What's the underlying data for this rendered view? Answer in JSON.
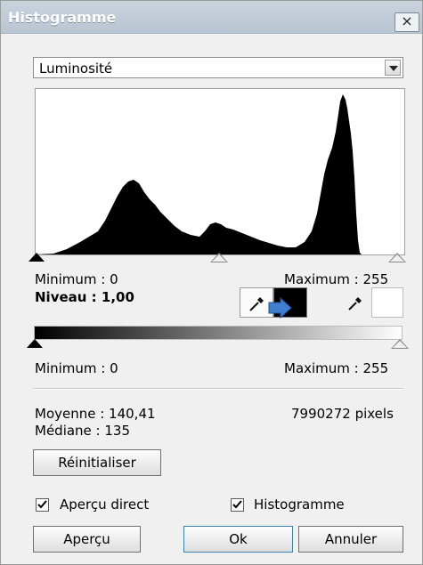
{
  "window": {
    "title": "Histogramme",
    "close_label": "×"
  },
  "channel": {
    "selected": "Luminosité"
  },
  "histogram": {
    "input_minimum": "Minimum : 0",
    "input_maximum": "Maximum : 255",
    "level": "Niveau : 1,00"
  },
  "output": {
    "minimum": "Minimum : 0",
    "maximum": "Maximum : 255"
  },
  "stats": {
    "mean": "Moyenne : 140,41",
    "median": "Médiane : 135",
    "pixels": "7990272 pixels"
  },
  "buttons": {
    "reset": "Réinitialiser",
    "preview": "Aperçu",
    "ok": "Ok",
    "cancel": "Annuler"
  },
  "options": {
    "live_preview": {
      "label": "Aperçu direct",
      "checked": true
    },
    "histogram": {
      "label": "Histogramme",
      "checked": true
    }
  },
  "colors": {
    "black_swatch": "#000000",
    "white_swatch": "#ffffff",
    "pointer_arrow": "#3f7fd0"
  }
}
